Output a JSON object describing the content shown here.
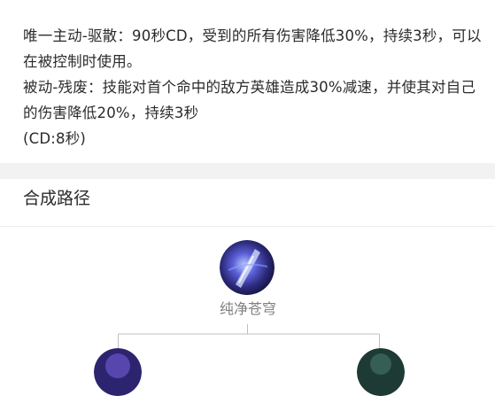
{
  "description": {
    "active": "唯一主动-驱散：90秒CD，受到的所有伤害降低30%，持续3秒，可以在被控制时使用。",
    "passive": "被动-残废：技能对首个命中的敌方英雄造成30%减速，并使其对自己的伤害降低20%，持续3秒",
    "cooldown": "(CD:8秒)"
  },
  "recipe": {
    "title": "合成路径",
    "item_name": "纯净苍穹",
    "item_icon": "pure-sky-item-icon",
    "component_icons": [
      "component-item-icon-left",
      "component-item-icon-right"
    ]
  }
}
